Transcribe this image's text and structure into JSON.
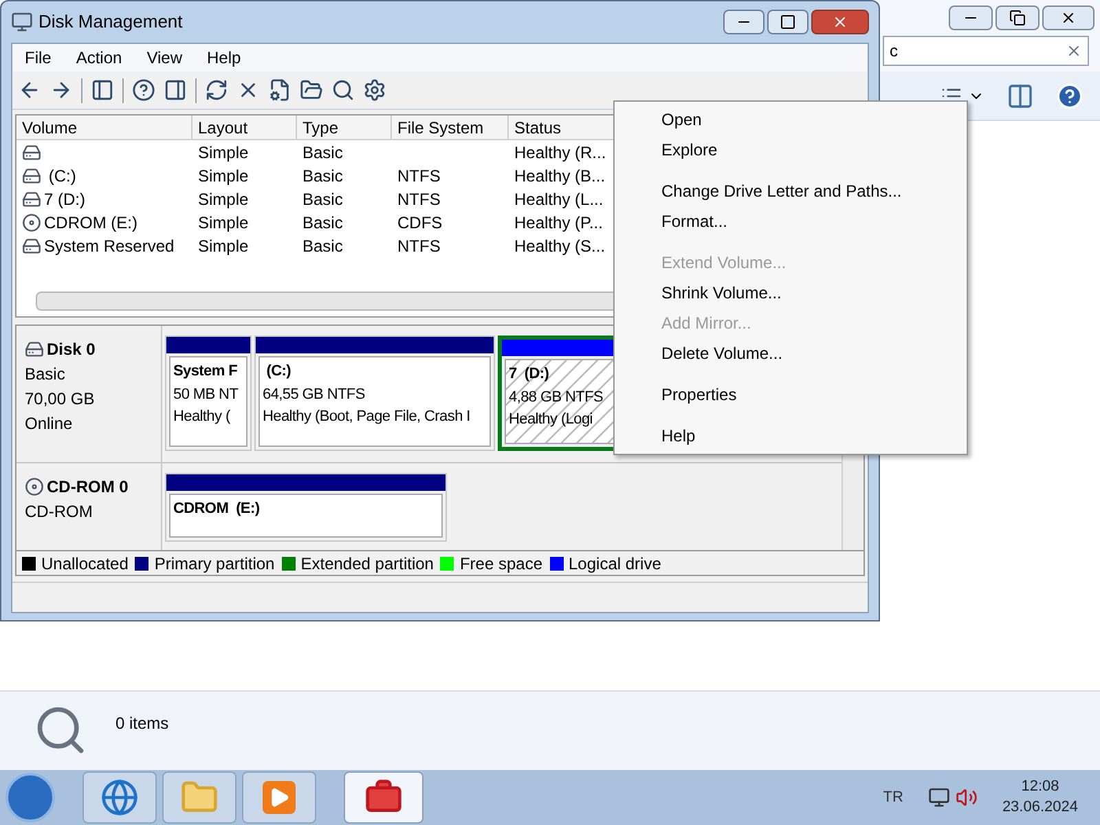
{
  "window": {
    "title": "Disk Management",
    "menu": [
      "File",
      "Action",
      "View",
      "Help"
    ]
  },
  "volumes": {
    "columns": [
      "Volume",
      "Layout",
      "Type",
      "File System",
      "Status"
    ],
    "rows": [
      {
        "kind": "disk",
        "layout": "Simple",
        "type": "Basic",
        "status": "Healthy (R..."
      },
      {
        "kind": "disk",
        "volume": " (C:)",
        "layout": "Simple",
        "type": "Basic",
        "file_system": "NTFS",
        "status": "Healthy (B..."
      },
      {
        "kind": "disk",
        "volume": "7 (D:)",
        "layout": "Simple",
        "type": "Basic",
        "file_system": "NTFS",
        "status": "Healthy (L..."
      },
      {
        "kind": "cdrom",
        "volume": "CDROM (E:)",
        "layout": "Simple",
        "type": "Basic",
        "file_system": "CDFS",
        "status": "Healthy (P..."
      },
      {
        "kind": "disk",
        "volume": "System Reserved",
        "layout": "Simple",
        "type": "Basic",
        "file_system": "NTFS",
        "status": "Healthy (S..."
      }
    ]
  },
  "disks": [
    {
      "kind": "disk",
      "name": "Disk 0",
      "lines": [
        "Basic",
        "70,00 GB",
        "Online"
      ],
      "partitions": [
        {
          "title": "System F",
          "lines": [
            "50 MB NT",
            "Healthy ("
          ],
          "color": "#000080",
          "selected": false,
          "hatched": false
        },
        {
          "title": " (C:)",
          "lines": [
            "64,55 GB NTFS",
            "Healthy (Boot, Page File, Crash I"
          ],
          "color": "#000080",
          "selected": false,
          "hatched": false
        },
        {
          "title": "7  (D:)",
          "lines": [
            "4,88 GB NTFS",
            "Healthy (Logi"
          ],
          "color": "#0000ff",
          "selected": true,
          "hatched": true
        }
      ]
    },
    {
      "kind": "cdrom",
      "name": "CD-ROM 0",
      "lines": [
        "CD-ROM"
      ],
      "partitions": [
        {
          "title": "CDROM  (E:)",
          "color": "#000080",
          "selected": false,
          "hatched": false
        }
      ]
    }
  ],
  "legend": [
    {
      "label": "Unallocated",
      "color": "#000000"
    },
    {
      "label": "Primary partition",
      "color": "#000080"
    },
    {
      "label": "Extended partition",
      "color": "#008000"
    },
    {
      "label": "Free space",
      "color": "#00ff00"
    },
    {
      "label": "Logical drive",
      "color": "#0000ff"
    }
  ],
  "context_menu": [
    [
      {
        "label": "Open",
        "disabled": false
      },
      {
        "label": "Explore",
        "disabled": false
      }
    ],
    [
      {
        "label": "Change Drive Letter and Paths...",
        "disabled": false
      },
      {
        "label": "Format...",
        "disabled": false
      }
    ],
    [
      {
        "label": "Extend Volume...",
        "disabled": true
      },
      {
        "label": "Shrink Volume...",
        "disabled": false
      },
      {
        "label": "Add Mirror...",
        "disabled": true
      },
      {
        "label": "Delete Volume...",
        "disabled": false
      }
    ],
    [
      {
        "label": "Properties",
        "disabled": false
      }
    ],
    [
      {
        "label": "Help",
        "disabled": false
      }
    ]
  ],
  "explorer": {
    "search": {
      "value": "c"
    },
    "status": "0 items"
  },
  "taskbar": {
    "apps": [
      {
        "kind": "browser",
        "selected": false
      },
      {
        "kind": "folder",
        "selected": false
      },
      {
        "kind": "media",
        "selected": false
      },
      {
        "kind": "toolbox",
        "selected": true
      }
    ],
    "language": "TR",
    "time": "12:08",
    "date": "23.06.2024"
  }
}
